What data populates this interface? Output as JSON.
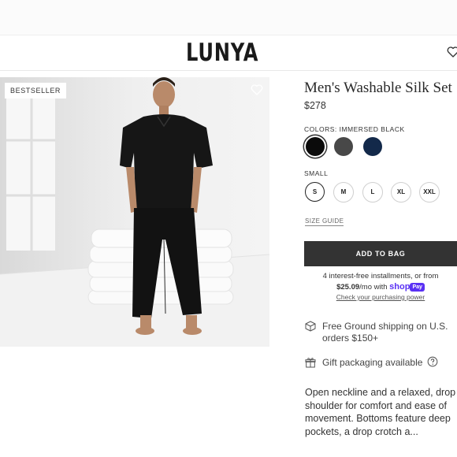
{
  "header": {
    "logo": "LUNYA",
    "wishlist_icon": "heart-icon"
  },
  "product_image": {
    "badge": "BESTSELLER",
    "favorite_icon": "heart-icon",
    "description": "Man wearing black short-sleeve silk pajama set standing next to stacked white pillows"
  },
  "product": {
    "title": "Men's Washable Silk Set",
    "price": "$278"
  },
  "colors": {
    "label": "COLORS: IMMERSED BLACK",
    "swatches": [
      {
        "name": "Immersed Black",
        "hex": "#0b0b0b",
        "selected": true
      },
      {
        "name": "Charcoal",
        "hex": "#484848",
        "selected": false
      },
      {
        "name": "Navy",
        "hex": "#13294a",
        "selected": false
      }
    ]
  },
  "sizes": {
    "label": "SMALL",
    "options": [
      "S",
      "M",
      "L",
      "XL",
      "XXL"
    ],
    "selected": "S"
  },
  "size_guide": "SIZE GUIDE",
  "add_to_bag": "ADD TO BAG",
  "installments": {
    "line1": "4 interest-free installments, or from",
    "amount": "$25.09",
    "per_mo": "/mo with",
    "shop_word": "shop",
    "pay_word": "Pay",
    "line3": "Check your purchasing power"
  },
  "features": [
    {
      "icon": "box-icon",
      "text": "Free Ground shipping on U.S. orders $150+"
    },
    {
      "icon": "gift-icon",
      "text": "Gift packaging available",
      "info_icon": "help-circle-icon"
    }
  ],
  "description": "Open neckline and a relaxed, drop shoulder for comfort and ease of movement. Bottoms feature deep pockets, a drop crotch a..."
}
